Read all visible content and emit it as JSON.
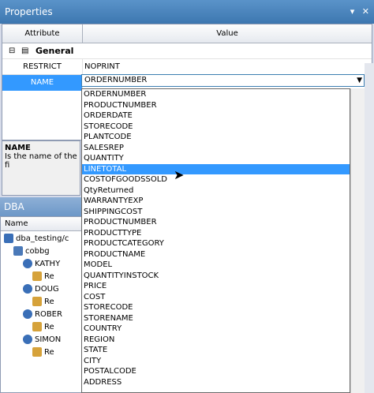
{
  "properties": {
    "title": "Properties",
    "pin": "▾",
    "close": "✕",
    "header_attr": "Attribute",
    "header_value": "Value",
    "group": "General",
    "rows": [
      {
        "attr": "RESTRICT",
        "value": "NOPRINT"
      },
      {
        "attr": "NAME",
        "value": "ORDERNUMBER"
      }
    ],
    "desc_title": "NAME",
    "desc_text": "Is the name of the fi"
  },
  "dropdown": {
    "selected": "ORDERNUMBER",
    "highlighted": "LINETOTAL",
    "items": [
      "ORDERNUMBER",
      "PRODUCTNUMBER",
      "ORDERDATE",
      "STORECODE",
      "PLANTCODE",
      "SALESREP",
      "QUANTITY",
      "LINETOTAL",
      "COSTOFGOODSSOLD",
      "QtyReturned",
      "WARRANTYEXP",
      "SHIPPINGCOST",
      "PRODUCTNUMBER",
      "PRODUCTTYPE",
      "PRODUCTCATEGORY",
      "PRODUCTNAME",
      "MODEL",
      "QUANTITYINSTOCK",
      "PRICE",
      "COST",
      "STORECODE",
      "STORENAME",
      "COUNTRY",
      "REGION",
      "STATE",
      "CITY",
      "POSTALCODE",
      "ADDRESS"
    ]
  },
  "dba": {
    "title": "DBA",
    "name_header": "Name",
    "tree": [
      {
        "label": "dba_testing/c",
        "level": 0
      },
      {
        "label": "cobbg",
        "level": 1
      },
      {
        "label": "KATHY",
        "level": 2
      },
      {
        "label": "Re",
        "level": 3
      },
      {
        "label": "DOUG",
        "level": 2
      },
      {
        "label": "Re",
        "level": 3
      },
      {
        "label": "ROBER",
        "level": 2
      },
      {
        "label": "Re",
        "level": 3
      },
      {
        "label": "SIMON",
        "level": 2
      },
      {
        "label": "Re",
        "level": 3
      }
    ]
  }
}
